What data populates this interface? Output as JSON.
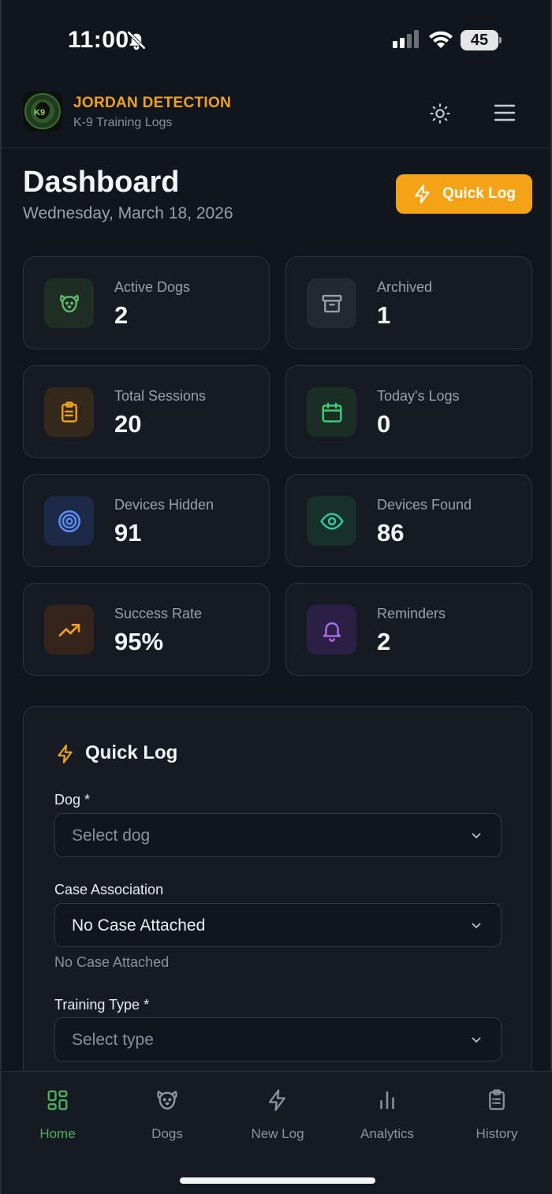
{
  "status_bar": {
    "time": "11:00",
    "battery": "45"
  },
  "header": {
    "brand": "JORDAN DETECTION",
    "subtitle": "K-9 Training Logs",
    "logo_text": "K9"
  },
  "page": {
    "title": "Dashboard",
    "date": "Wednesday, March 18, 2026",
    "quick_log_button": "Quick Log"
  },
  "stats": [
    {
      "label": "Active Dogs",
      "value": "2",
      "icon": "dog-icon",
      "color": "#5fb96a"
    },
    {
      "label": "Archived",
      "value": "1",
      "icon": "archive-icon",
      "color": "#9aa0ab"
    },
    {
      "label": "Total Sessions",
      "value": "20",
      "icon": "clipboard-icon",
      "color": "#f0a21f"
    },
    {
      "label": "Today's Logs",
      "value": "0",
      "icon": "calendar-icon",
      "color": "#3fd07a"
    },
    {
      "label": "Devices Hidden",
      "value": "91",
      "icon": "target-icon",
      "color": "#5b8cf5"
    },
    {
      "label": "Devices Found",
      "value": "86",
      "icon": "eye-icon",
      "color": "#34c79b"
    },
    {
      "label": "Success Rate",
      "value": "95%",
      "icon": "trending-up-icon",
      "color": "#f0a21f"
    },
    {
      "label": "Reminders",
      "value": "2",
      "icon": "bell-icon",
      "color": "#b26cf0"
    }
  ],
  "quick_log": {
    "title": "Quick Log",
    "dog_label": "Dog *",
    "dog_placeholder": "Select dog",
    "case_label": "Case Association",
    "case_value": "No Case Attached",
    "case_hint": "No Case Attached",
    "type_label": "Training Type *",
    "type_placeholder": "Select type"
  },
  "nav": [
    {
      "label": "Home",
      "icon": "grid-icon",
      "active": true
    },
    {
      "label": "Dogs",
      "icon": "dog-icon",
      "active": false
    },
    {
      "label": "New Log",
      "icon": "bolt-icon",
      "active": false
    },
    {
      "label": "Analytics",
      "icon": "bar-chart-icon",
      "active": false
    },
    {
      "label": "History",
      "icon": "clipboard-icon",
      "active": false
    }
  ],
  "colors": {
    "accent": "#f4a216",
    "active_nav": "#4fae5d",
    "background": "#11151d",
    "card": "#161b23"
  }
}
